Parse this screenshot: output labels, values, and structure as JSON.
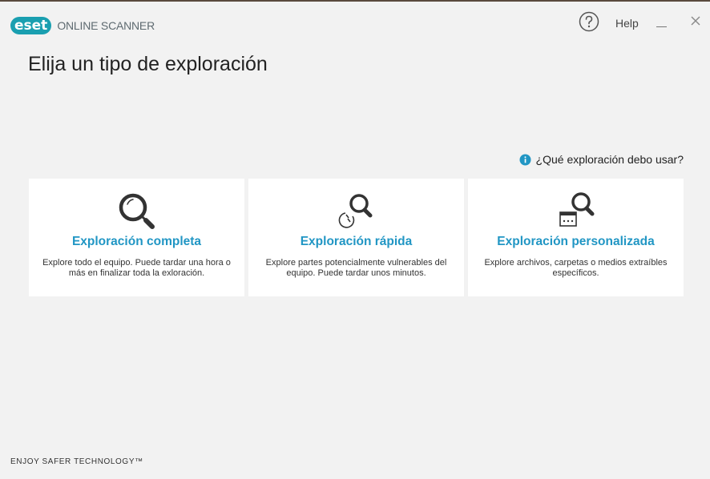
{
  "app": {
    "logo_badge": "eset",
    "logo_text": "ONLINE SCANNER"
  },
  "titlebar": {
    "help_label": "Help"
  },
  "page": {
    "title": "Elija un tipo de exploración",
    "help_link": "¿Qué exploración debo usar?"
  },
  "cards": [
    {
      "icon": "magnifier-icon",
      "title": "Exploración completa",
      "description": "Explore todo el equipo. Puede tardar una hora o más en finalizar toda la exloración."
    },
    {
      "icon": "quick-scan-icon",
      "title": "Exploración rápida",
      "description": "Explore partes potencialmente vulnerables del equipo. Puede tardar unos minutos."
    },
    {
      "icon": "custom-scan-icon",
      "title": "Exploración personalizada",
      "description": "Explore archivos, carpetas o medios extraíbles específicos."
    }
  ],
  "footer": {
    "tagline": "ENJOY SAFER TECHNOLOGY™"
  },
  "colors": {
    "accent": "#2196c4",
    "logo": "#1a9fb0",
    "background": "#f2f2f2",
    "card": "#ffffff"
  }
}
